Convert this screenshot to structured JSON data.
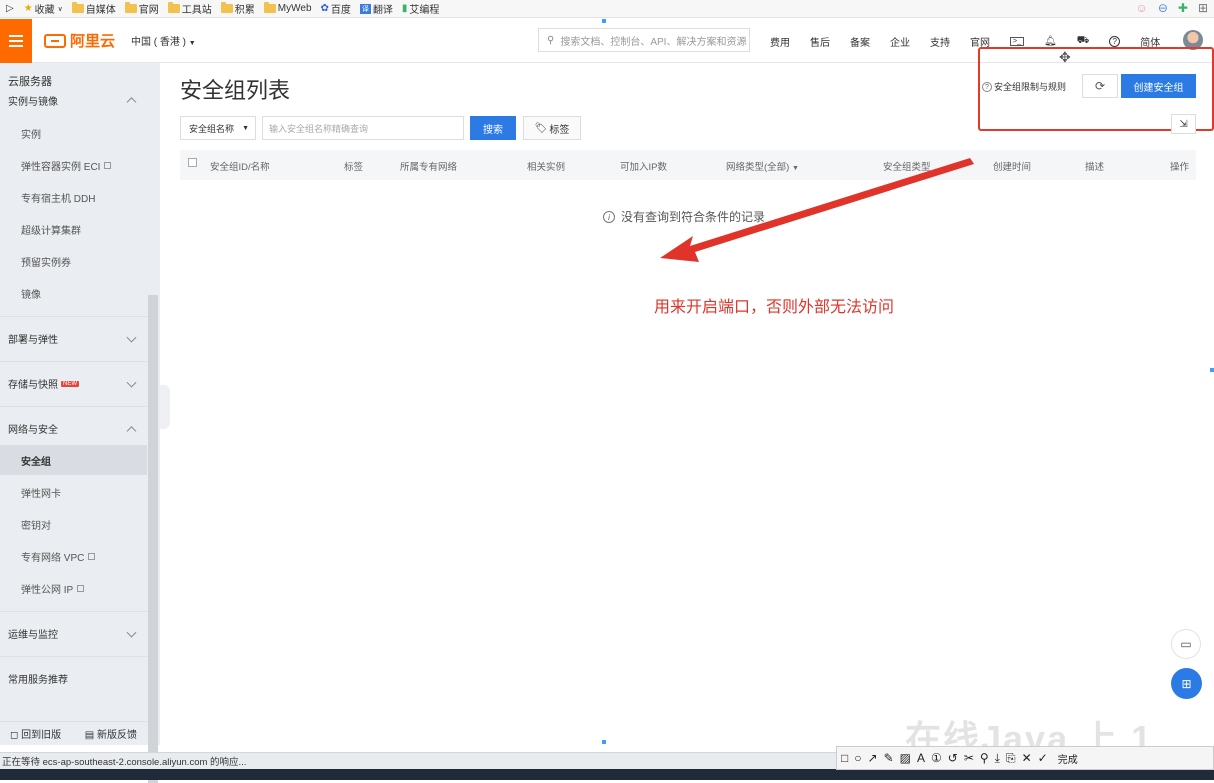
{
  "bookmarks": [
    {
      "label": "收藏",
      "icon": "star-icon"
    },
    {
      "label": "自媒体",
      "icon": "folder-icon"
    },
    {
      "label": "官网",
      "icon": "folder-icon"
    },
    {
      "label": "工具站",
      "icon": "folder-icon"
    },
    {
      "label": "积累",
      "icon": "folder-icon"
    },
    {
      "label": "MyWeb",
      "icon": "folder-icon"
    },
    {
      "label": "百度",
      "icon": "paw-icon"
    },
    {
      "label": "翻译",
      "icon": "translate-icon"
    },
    {
      "label": "艾编程",
      "icon": "bookmark-icon"
    }
  ],
  "header": {
    "logo_text": "阿里云",
    "region": "中国 ( 香港 )",
    "search_placeholder": "搜索文档、控制台、API、解决方案和资源",
    "nav_links": [
      "费用",
      "售后",
      "备案",
      "企业",
      "支持",
      "官网"
    ],
    "lang": "简体"
  },
  "sidebar": {
    "title": "云服务器",
    "section_instances": "实例与镜像",
    "items_instances": [
      {
        "label": "实例",
        "external": false
      },
      {
        "label": "弹性容器实例 ECI",
        "external": true
      },
      {
        "label": "专有宿主机 DDH",
        "external": false
      },
      {
        "label": "超级计算集群",
        "external": false
      },
      {
        "label": "预留实例券",
        "external": false
      },
      {
        "label": "镜像",
        "external": false
      }
    ],
    "group_deploy": "部署与弹性",
    "group_storage": "存储与快照",
    "badge_new": "NEW",
    "group_network": "网络与安全",
    "items_network": [
      {
        "label": "安全组",
        "external": false
      },
      {
        "label": "弹性网卡",
        "external": false
      },
      {
        "label": "密钥对",
        "external": false
      },
      {
        "label": "专有网络 VPC",
        "external": true
      },
      {
        "label": "弹性公网 IP",
        "external": true
      }
    ],
    "group_ops": "运维与监控",
    "group_recommend": "常用服务推荐",
    "back_old": "回到旧版",
    "new_feedback": "新版反馈"
  },
  "main": {
    "title": "安全组列表",
    "rules_link": "安全组限制与规则",
    "create_button": "创建安全组",
    "filter_select": "安全组名称",
    "filter_placeholder": "输入安全组名称精确查询",
    "search_button": "搜索",
    "tag_button": "标签",
    "columns": [
      "安全组ID/名称",
      "标签",
      "所属专有网络",
      "相关实例",
      "可加入IP数",
      "网络类型(全部)",
      "安全组类型",
      "创建时间",
      "描述",
      "操作"
    ],
    "empty_text": "没有查询到符合条件的记录"
  },
  "annotation": {
    "text": "用来开启端口，否则外部无法访问",
    "color": "#e0342a"
  },
  "watermark": "在线Java 上 1 _",
  "statusbar": {
    "text": "正在等待 ecs-ap-southeast-2.console.aliyun.com 的响应..."
  },
  "snip_toolbar": {
    "done_label": "完成"
  },
  "colors": {
    "brand": "#ff6a00",
    "primary": "#2c7be5",
    "highlight": "#e23a2a"
  }
}
